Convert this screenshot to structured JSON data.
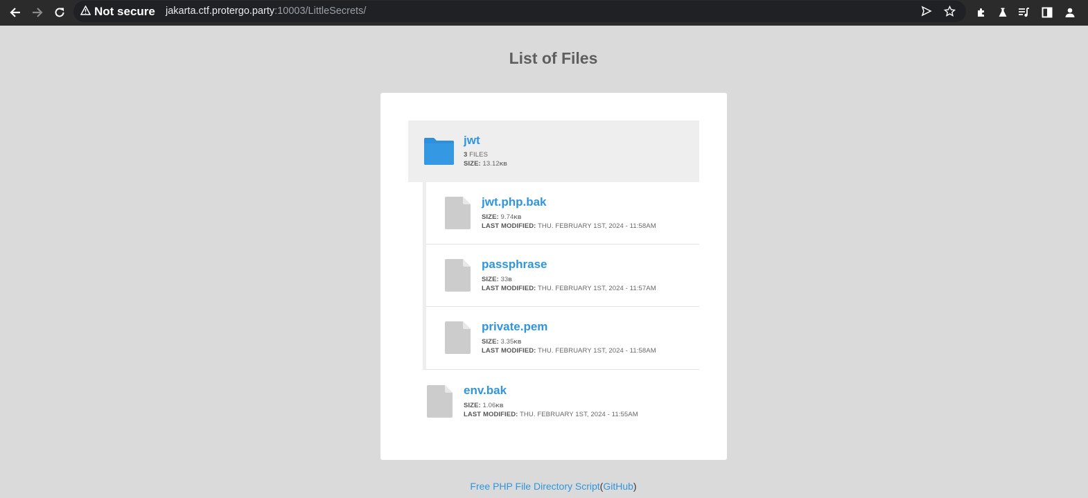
{
  "browser": {
    "security_label": "Not secure",
    "url_host": "jakarta.ctf.protergo.party",
    "url_path": ":10003/LittleSecrets/"
  },
  "page": {
    "title": "List of Files"
  },
  "folder": {
    "name": "jwt",
    "file_count": "3",
    "files_label": "FILES",
    "size_label": "SIZE:",
    "size_value": "13.12",
    "size_unit": "KB"
  },
  "labels": {
    "size": "SIZE:",
    "modified": "LAST MODIFIED:"
  },
  "files": [
    {
      "name": "jwt.php.bak",
      "size_value": "9.74",
      "size_unit": "KB",
      "modified": "THU. FEBRUARY 1ST, 2024 - 11:58AM"
    },
    {
      "name": "passphrase",
      "size_value": "33",
      "size_unit": "B",
      "modified": "THU. FEBRUARY 1ST, 2024 - 11:57AM"
    },
    {
      "name": "private.pem",
      "size_value": "3.35",
      "size_unit": "KB",
      "modified": "THU. FEBRUARY 1ST, 2024 - 11:58AM"
    }
  ],
  "root_file": {
    "name": "env.bak",
    "size_value": "1.06",
    "size_unit": "KB",
    "modified": "THU. FEBRUARY 1ST, 2024 - 11:55AM"
  },
  "footer": {
    "script_link": "Free PHP File Directory Script",
    "open_paren": "(",
    "github_link": "GitHub",
    "close_paren": ")"
  },
  "colors": {
    "link": "#3095dc",
    "folder": "#2f8fdc",
    "file_icon": "#cccccc",
    "page_bg": "#dadada"
  },
  "icons": [
    "back-arrow-icon",
    "forward-arrow-icon",
    "reload-icon",
    "warning-icon",
    "send-icon",
    "star-icon",
    "extensions-icon",
    "labs-icon",
    "reading-list-icon",
    "side-panel-icon",
    "profile-icon",
    "folder-icon",
    "file-icon"
  ]
}
